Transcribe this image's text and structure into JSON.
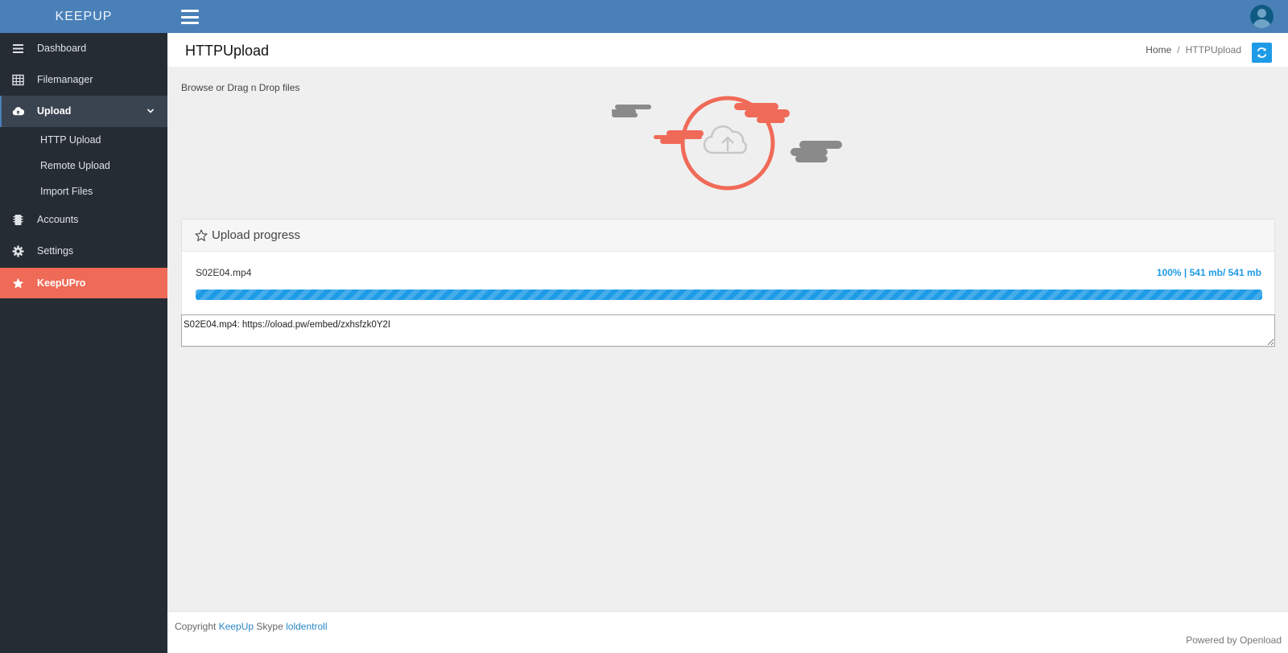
{
  "app": {
    "brand": "KEEPUP"
  },
  "sidebar": {
    "items": [
      {
        "label": "Dashboard",
        "icon": "menu-icon"
      },
      {
        "label": "Filemanager",
        "icon": "table-icon"
      },
      {
        "label": "Upload",
        "icon": "cloud-upload-icon",
        "active": true,
        "children": [
          {
            "label": "HTTP Upload"
          },
          {
            "label": "Remote Upload"
          },
          {
            "label": "Import Files"
          }
        ]
      },
      {
        "label": "Accounts",
        "icon": "chip-icon"
      },
      {
        "label": "Settings",
        "icon": "gear-icon"
      },
      {
        "label": "KeepUPro",
        "icon": "star-icon",
        "highlight_color": "#f06a58"
      }
    ]
  },
  "header": {
    "title": "HTTPUpload",
    "breadcrumb": {
      "home": "Home",
      "separator": "/",
      "current": "HTTPUpload"
    }
  },
  "main": {
    "drop_label": "Browse or Drag n Drop files",
    "panel": {
      "title": "Upload progress",
      "file_name": "S02E04.mp4",
      "progress_text": "100% | 541 mb/ 541 mb",
      "progress_fraction": 1.0
    },
    "result_text": "S02E04.mp4: https://oload.pw/embed/zxhsfzk0Y2I"
  },
  "footer": {
    "copyright": "Copyright",
    "brand_link": "KeepUp",
    "skype_label": "Skype",
    "skype_link": "loldentroll",
    "powered": "Powered by Openload"
  },
  "colors": {
    "topbar": "#4a80b8",
    "sidebar": "#252c34",
    "accent": "#1e9be6",
    "highlight": "#f06a58"
  }
}
